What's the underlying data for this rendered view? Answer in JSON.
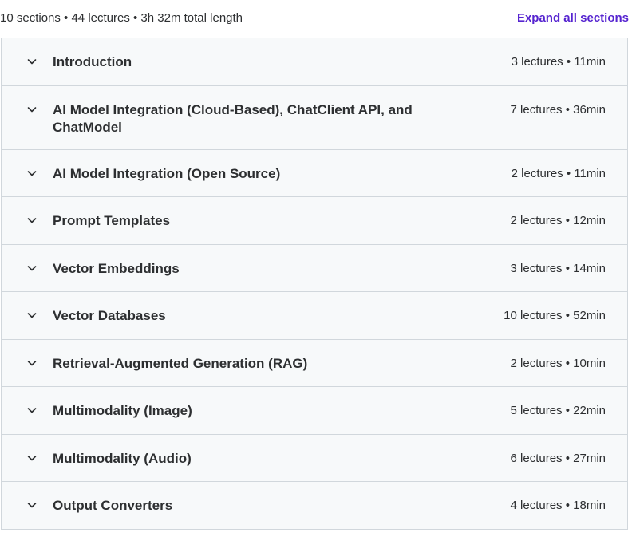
{
  "header": {
    "summary": "10 sections • 44 lectures • 3h 32m total length",
    "expand_all_label": "Expand all sections"
  },
  "colors": {
    "accent": "#5624d0",
    "section_bg": "#f7f9fa",
    "border": "#d1d7dc",
    "text": "#2d2f31"
  },
  "sections": [
    {
      "title": "Introduction",
      "meta": "3 lectures • 11min"
    },
    {
      "title": "AI Model Integration (Cloud-Based), ChatClient API, and ChatModel",
      "meta": "7 lectures • 36min"
    },
    {
      "title": "AI Model Integration (Open Source)",
      "meta": "2 lectures • 11min"
    },
    {
      "title": "Prompt Templates",
      "meta": "2 lectures • 12min"
    },
    {
      "title": "Vector Embeddings",
      "meta": "3 lectures • 14min"
    },
    {
      "title": "Vector Databases",
      "meta": "10 lectures • 52min"
    },
    {
      "title": "Retrieval-Augmented Generation (RAG)",
      "meta": "2 lectures • 10min"
    },
    {
      "title": "Multimodality (Image)",
      "meta": "5 lectures • 22min"
    },
    {
      "title": "Multimodality (Audio)",
      "meta": "6 lectures • 27min"
    },
    {
      "title": "Output Converters",
      "meta": "4 lectures • 18min"
    }
  ]
}
